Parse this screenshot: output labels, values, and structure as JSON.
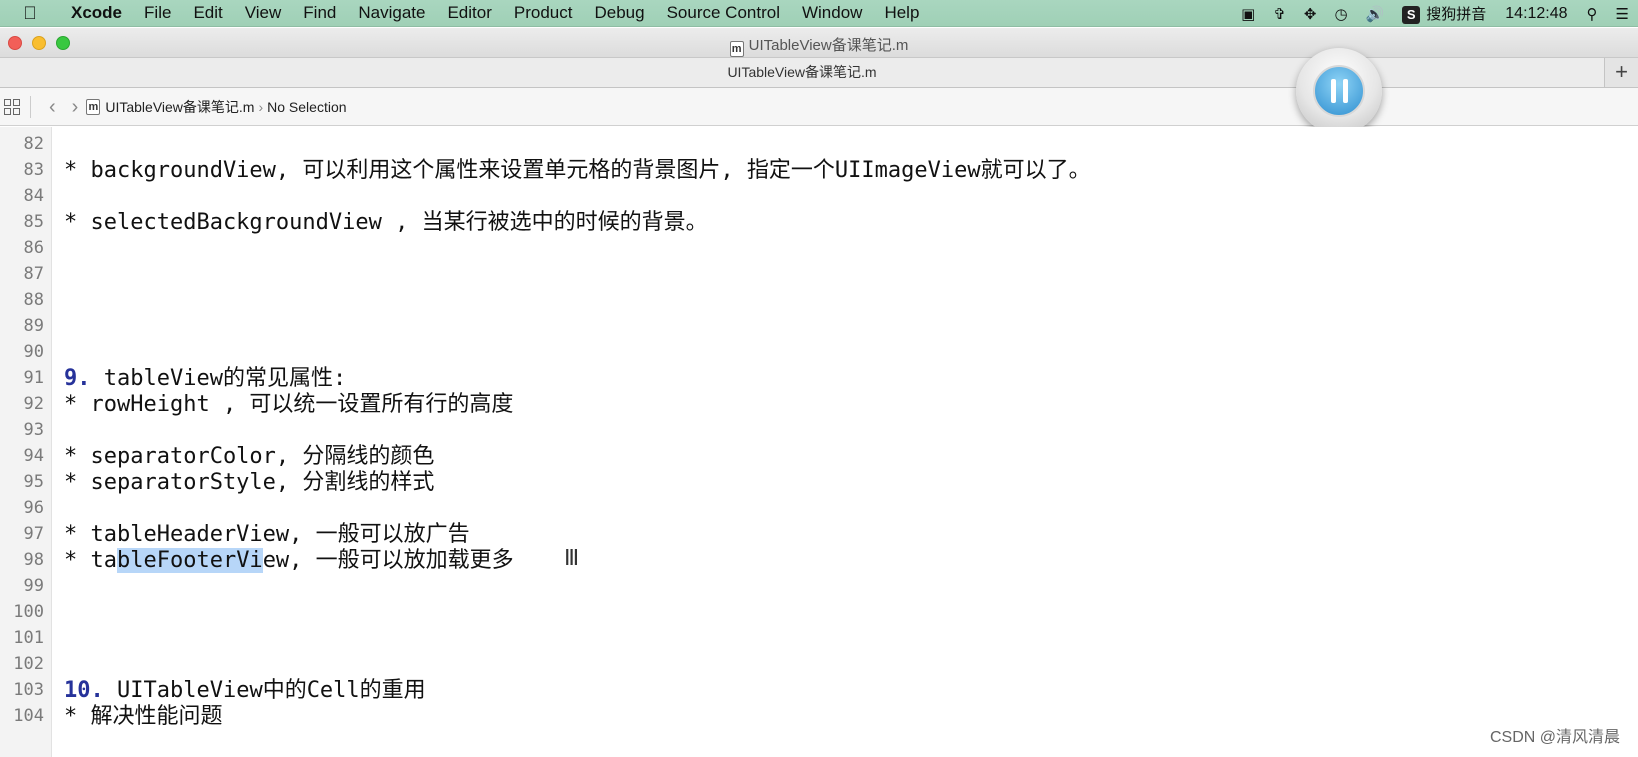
{
  "menubar": {
    "app": "Xcode",
    "items": [
      "File",
      "Edit",
      "View",
      "Find",
      "Navigate",
      "Editor",
      "Product",
      "Debug",
      "Source Control",
      "Window",
      "Help"
    ],
    "status": {
      "ime_label": "搜狗拼音",
      "clock": "14:12:48"
    }
  },
  "window": {
    "title": "UITableView备课笔记.m",
    "tab": "UITableView备课笔记.m",
    "file_badge": "m"
  },
  "jumpbar": {
    "file": "UITableView备课笔记.m",
    "selection": "No Selection"
  },
  "editor": {
    "lines": [
      {
        "n": "82",
        "text": ""
      },
      {
        "n": "83",
        "text": "* backgroundView, 可以利用这个属性来设置单元格的背景图片, 指定一个UIImageView就可以了。"
      },
      {
        "n": "84",
        "text": ""
      },
      {
        "n": "85",
        "text": "* selectedBackgroundView , 当某行被选中的时候的背景。"
      },
      {
        "n": "86",
        "text": ""
      },
      {
        "n": "87",
        "text": ""
      },
      {
        "n": "88",
        "text": ""
      },
      {
        "n": "89",
        "text": ""
      },
      {
        "n": "90",
        "text": ""
      },
      {
        "n": "91",
        "num": "9.",
        "text": " tableView的常见属性:"
      },
      {
        "n": "92",
        "text": "* rowHeight , 可以统一设置所有行的高度"
      },
      {
        "n": "93",
        "text": ""
      },
      {
        "n": "94",
        "text": "* separatorColor, 分隔线的颜色"
      },
      {
        "n": "95",
        "text": "* separatorStyle, 分割线的样式"
      },
      {
        "n": "96",
        "text": ""
      },
      {
        "n": "97",
        "text": "* tableHeaderView, 一般可以放广告"
      },
      {
        "n": "98",
        "pre": "* ta",
        "sel": "bleFooterVi",
        "text": "ew, 一般可以放加载更多"
      },
      {
        "n": "99",
        "text": ""
      },
      {
        "n": "100",
        "text": ""
      },
      {
        "n": "101",
        "text": ""
      },
      {
        "n": "102",
        "text": ""
      },
      {
        "n": "103",
        "num": "10.",
        "text": " UITableView中的Cell的重用"
      },
      {
        "n": "104",
        "text": "* 解决性能问题"
      }
    ]
  },
  "watermark": "CSDN @清风清晨"
}
